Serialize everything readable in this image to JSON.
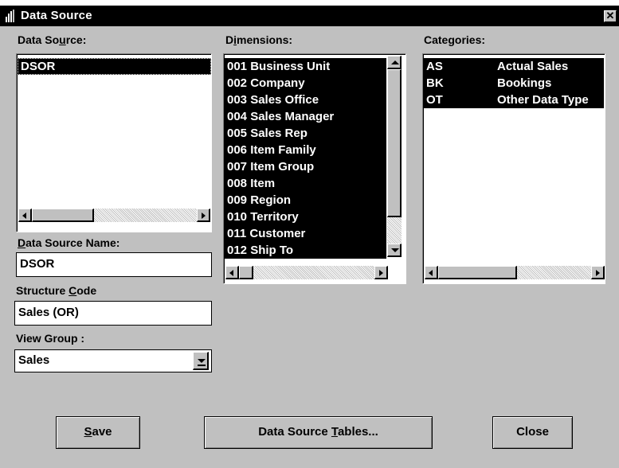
{
  "window": {
    "title": "Data Source",
    "icon": "app-icon",
    "close_glyph": "✕"
  },
  "data_source_list": {
    "label_pre": "Data So",
    "label_mnemonic": "u",
    "label_post": "rce:",
    "items": [
      "DSOR"
    ]
  },
  "dimensions_list": {
    "label_pre": "D",
    "label_mnemonic": "i",
    "label_post": "mensions:",
    "items": [
      "001 Business Unit",
      "002 Company",
      "003 Sales Office",
      "004 Sales Manager",
      "005 Sales Rep",
      "006 Item Family",
      "007 Item Group",
      "008 Item",
      "009 Region",
      "010 Territory",
      "011 Customer",
      "012 Ship To"
    ]
  },
  "categories_list": {
    "label_pre": "Cate",
    "label_mnemonic": "g",
    "label_post": "ories:",
    "items": [
      {
        "code": "AS",
        "name": "Actual Sales"
      },
      {
        "code": "BK",
        "name": "Bookings"
      },
      {
        "code": "OT",
        "name": "Other Data Type"
      }
    ]
  },
  "data_source_name": {
    "label_mnemonic": "D",
    "label_post": "ata Source Name:",
    "value": "DSOR"
  },
  "structure_code": {
    "label_pre": "Structure ",
    "label_mnemonic": "C",
    "label_post": "ode",
    "value": "Sales (OR)"
  },
  "view_group": {
    "label": "View Group :",
    "selected": "Sales"
  },
  "buttons": {
    "save": {
      "mnemonic": "S",
      "post": "ave"
    },
    "tables": {
      "pre": "Data Source ",
      "mnemonic": "T",
      "post": "ables..."
    },
    "close": {
      "label": "Close"
    }
  }
}
